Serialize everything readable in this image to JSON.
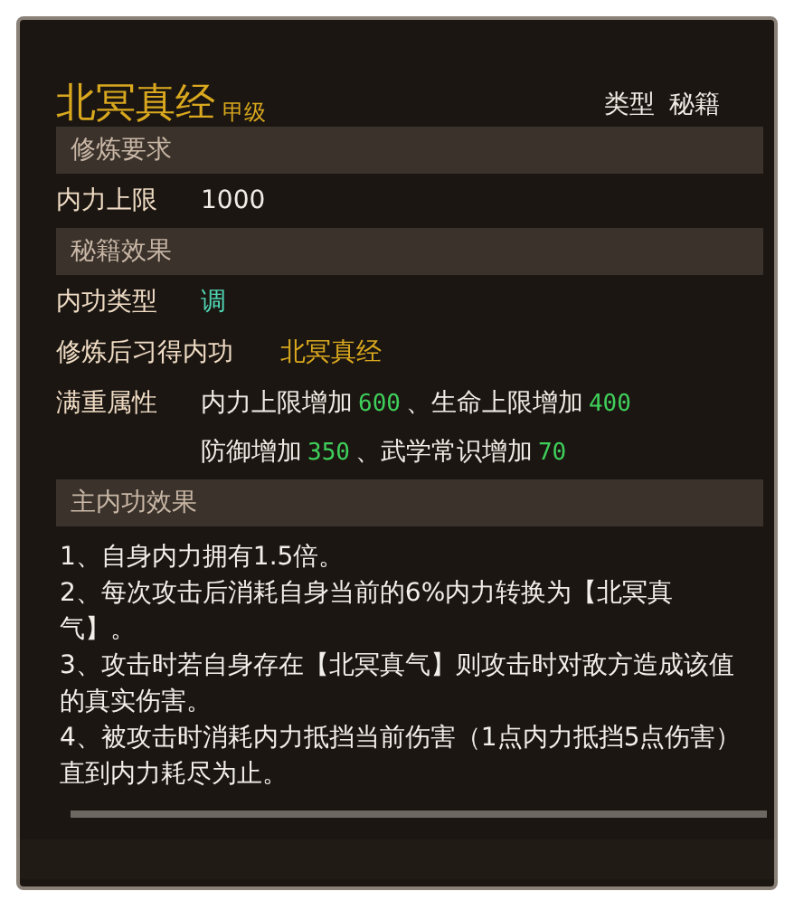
{
  "title": "北冥真经",
  "grade": "甲级",
  "type_label": "类型",
  "type_value": "秘籍",
  "sections": [
    {
      "header": "修炼要求",
      "rows": [
        {
          "label": "内力上限",
          "lines": [
            [
              {
                "text": "1000",
                "kind": "plain"
              }
            ]
          ]
        }
      ]
    },
    {
      "header": "秘籍效果",
      "rows": [
        {
          "label": "内功类型",
          "lines": [
            [
              {
                "text": "调",
                "kind": "teal"
              }
            ]
          ]
        },
        {
          "label": "修炼后习得内功",
          "lines": [
            [
              {
                "text": "北冥真经",
                "kind": "gold"
              }
            ]
          ]
        },
        {
          "label": "满重属性",
          "lines": [
            [
              {
                "text": "内力上限增加",
                "kind": "plain"
              },
              {
                "text": "600",
                "kind": "number"
              },
              {
                "text": "、生命上限增加",
                "kind": "plain"
              },
              {
                "text": "400",
                "kind": "number"
              }
            ],
            [
              {
                "text": "防御增加",
                "kind": "plain"
              },
              {
                "text": "350",
                "kind": "number"
              },
              {
                "text": "、武学常识增加",
                "kind": "plain"
              },
              {
                "text": "70",
                "kind": "number"
              }
            ]
          ]
        }
      ]
    },
    {
      "header": "主内功效果",
      "paragraphs": [
        "1、自身内力拥有1.5倍。",
        "2、每次攻击后消耗自身当前的6%内力转换为【北冥真气】。",
        "3、攻击时若自身存在【北冥真气】则攻击时对敌方造成该值的真实伤害。",
        "4、被攻击时消耗内力抵挡当前伤害（1点内力抵挡5点伤害）直到内力耗尽为止。"
      ]
    }
  ]
}
